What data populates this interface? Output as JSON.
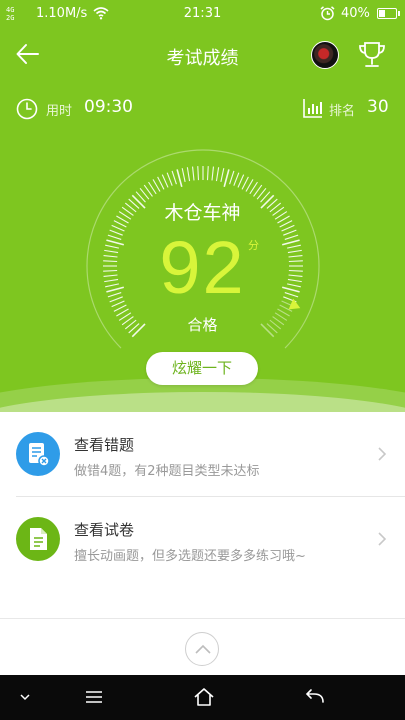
{
  "status_bar": {
    "signal_top": "4G",
    "signal_bottom": "2G",
    "net_speed": "1.10M/s",
    "time": "21:31",
    "battery_pct": "40%",
    "battery_level": 0.4
  },
  "header": {
    "title": "考试成绩"
  },
  "info": {
    "time_label": "用时",
    "time_value": "09:30",
    "rank_label": "排名",
    "rank_value": "30"
  },
  "result": {
    "username": "木仓车神",
    "score": "92",
    "score_unit": "分",
    "verdict": "合格",
    "share_label": "炫耀一下",
    "accent_color": "#d8f53a"
  },
  "list": [
    {
      "title": "查看错题",
      "subtitle": "做错4题，有2种题目类型未达标",
      "icon": "wrong-questions-icon",
      "color": "#2f9ce8"
    },
    {
      "title": "查看试卷",
      "subtitle": "擅长动画题，但多选题还要多多练习哦~",
      "icon": "exam-paper-icon",
      "color": "#6cb616"
    }
  ],
  "theme": {
    "primary": "#7ec620",
    "nav_bg": "#0a0a0a"
  }
}
